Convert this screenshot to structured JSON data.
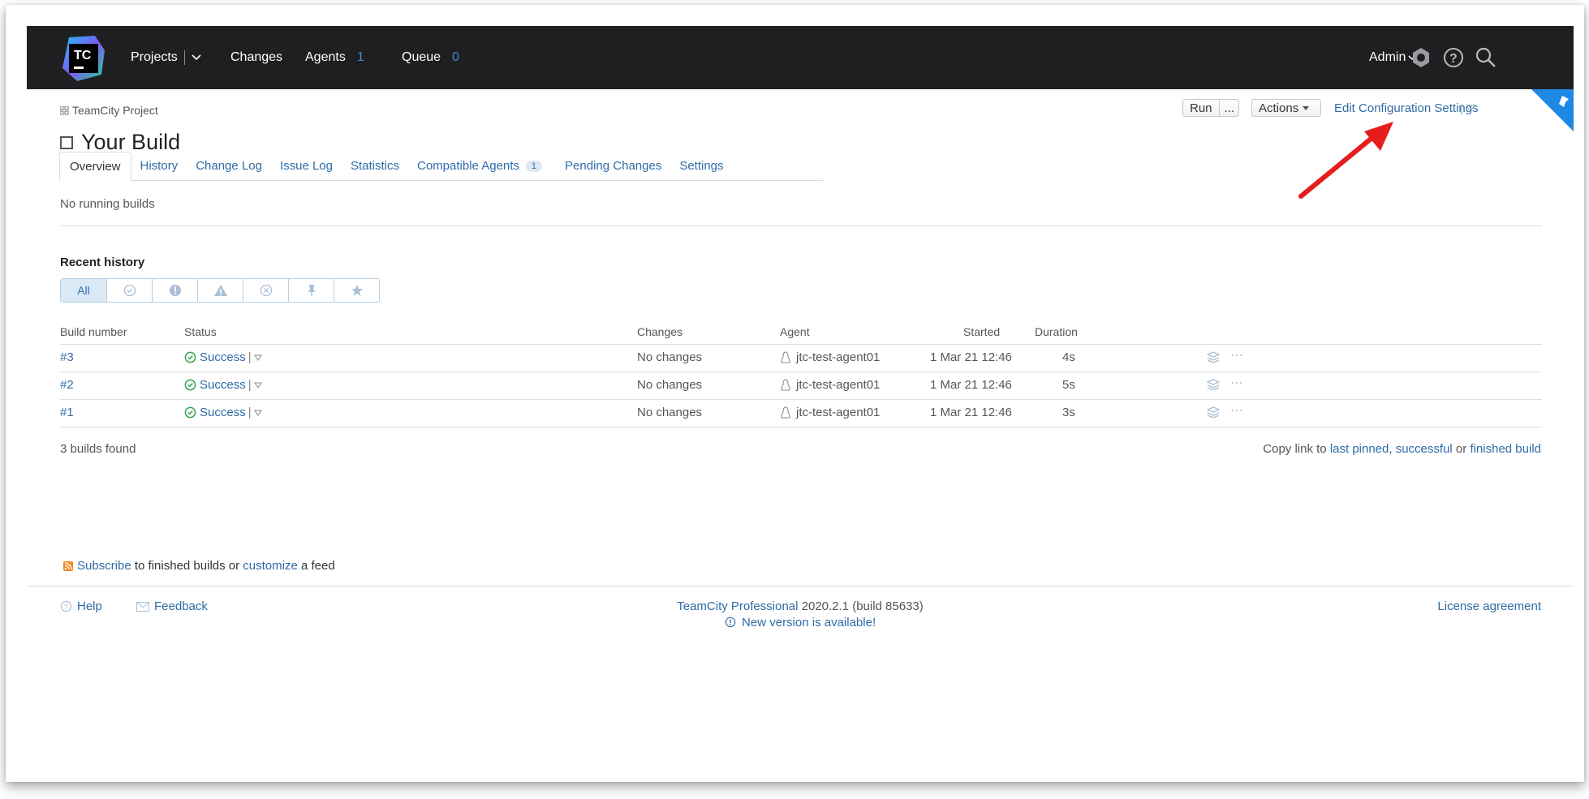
{
  "header": {
    "logo_text": "TC",
    "projects": "Projects",
    "changes": "Changes",
    "agents": "Agents",
    "agents_count": "1",
    "queue": "Queue",
    "queue_count": "0",
    "admin": "Admin"
  },
  "breadcrumb": "TeamCity Project",
  "page_title": "Your Build",
  "toolbar": {
    "run": "Run",
    "run_more": "...",
    "actions": "Actions",
    "edit_settings": "Edit Configuration Settings"
  },
  "tabs": [
    {
      "label": "Overview"
    },
    {
      "label": "History"
    },
    {
      "label": "Change Log"
    },
    {
      "label": "Issue Log"
    },
    {
      "label": "Statistics"
    },
    {
      "label": "Compatible Agents",
      "badge": "1"
    },
    {
      "label": "Pending Changes"
    },
    {
      "label": "Settings"
    }
  ],
  "no_running": "No running builds",
  "recent_history": "Recent history",
  "filter_all": "All",
  "table": {
    "headers": {
      "build_number": "Build number",
      "status": "Status",
      "changes": "Changes",
      "agent": "Agent",
      "started": "Started",
      "duration": "Duration"
    },
    "rows": [
      {
        "number": "#3",
        "status": "Success",
        "changes": "No changes",
        "agent": "jtc-test-agent01",
        "started": "1 Mar 21 12:46",
        "duration": "4s"
      },
      {
        "number": "#2",
        "status": "Success",
        "changes": "No changes",
        "agent": "jtc-test-agent01",
        "started": "1 Mar 21 12:46",
        "duration": "5s"
      },
      {
        "number": "#1",
        "status": "Success",
        "changes": "No changes",
        "agent": "jtc-test-agent01",
        "started": "1 Mar 21 12:46",
        "duration": "3s"
      }
    ]
  },
  "builds_found": "3 builds found",
  "copy_link": {
    "prefix": "Copy link to",
    "last_pinned": "last pinned",
    "comma": ",",
    "successful": "successful",
    "or": "or",
    "finished_build": "finished build"
  },
  "subscribe": {
    "subscribe_link": "Subscribe",
    "middle": "to finished builds or",
    "customize_link": "customize",
    "suffix": "a feed"
  },
  "footer": {
    "help": "Help",
    "feedback": "Feedback",
    "product": "TeamCity Professional",
    "version": "2020.2.1 (build 85633)",
    "new_version": "New version is available!",
    "license": "License agreement"
  },
  "colors": {
    "header_bg": "#1f1f22",
    "link": "#2e6ca6",
    "accent": "#1e88e5",
    "success": "#2ea44f",
    "arrow": "#e51d1d"
  }
}
